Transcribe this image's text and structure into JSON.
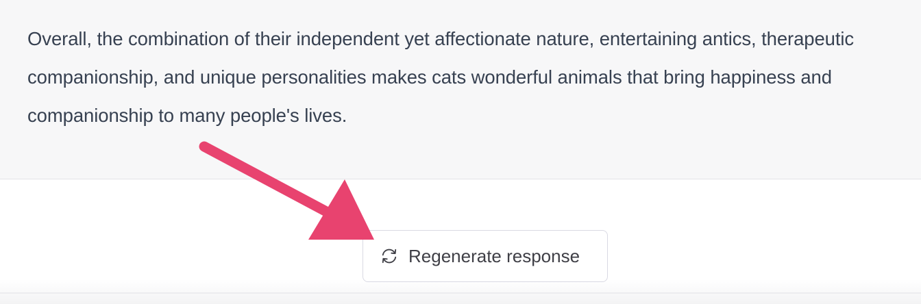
{
  "message": {
    "text": "Overall, the combination of their independent yet affectionate nature, entertaining antics, therapeutic companionship, and unique personalities makes cats wonderful animals that bring happiness and companionship to many people's lives."
  },
  "regenerate_button": {
    "label": "Regenerate response",
    "icon": "refresh-icon"
  },
  "colors": {
    "message_bg": "#f7f7f8",
    "text": "#374151",
    "button_border": "#d9d9e3",
    "annotation_arrow": "#e8436f"
  }
}
